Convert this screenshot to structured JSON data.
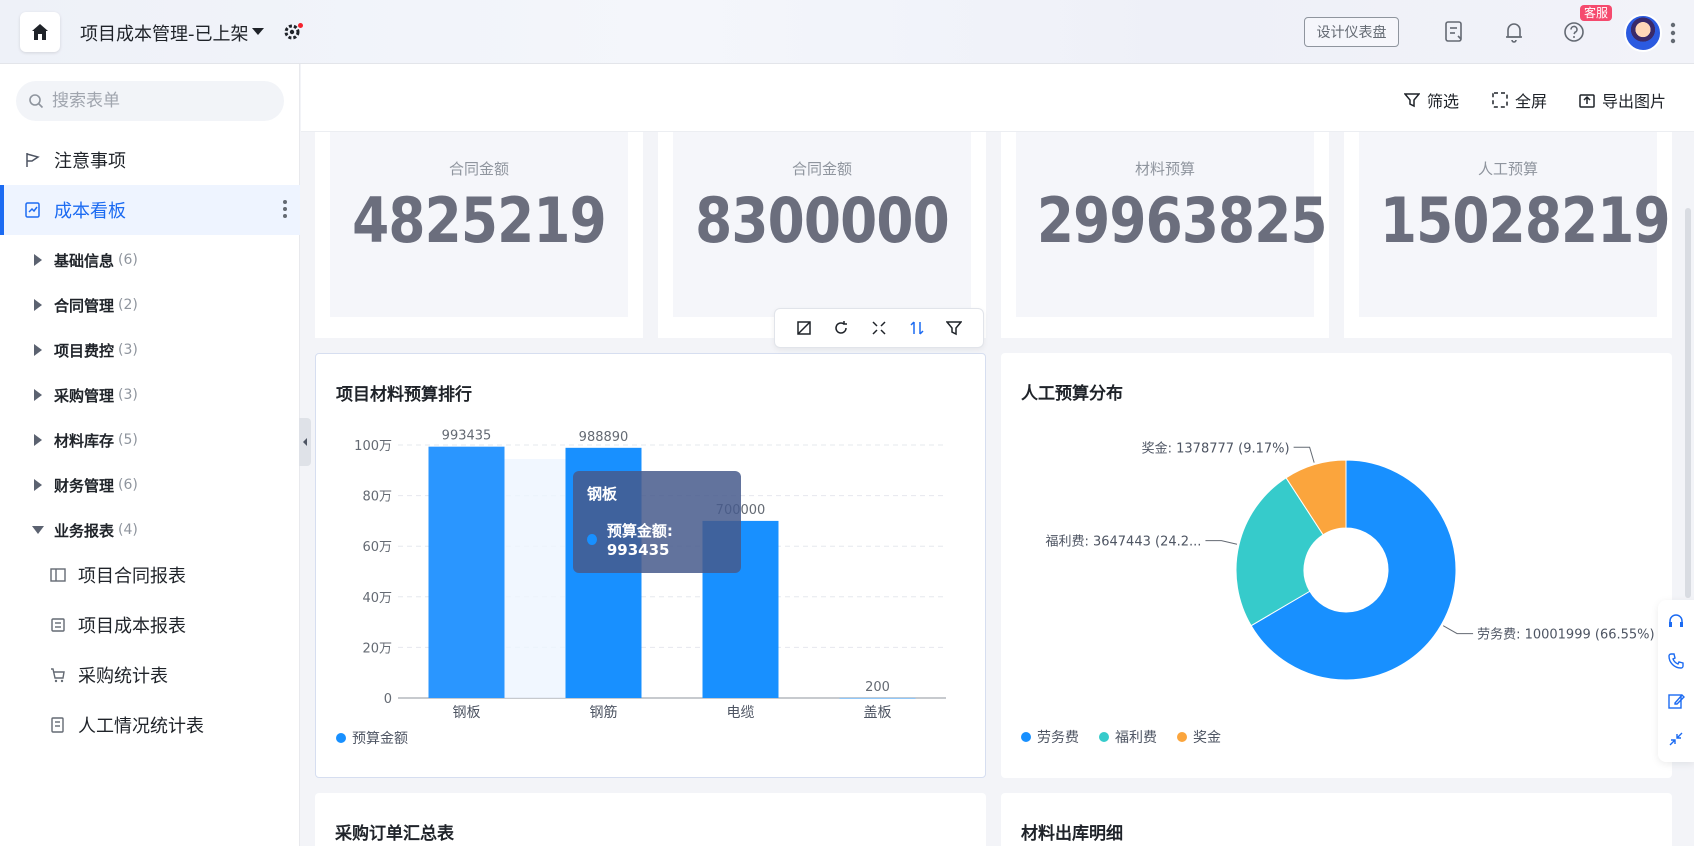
{
  "header": {
    "app_title": "项目成本管理-已上架",
    "design_button": "设计仪表盘",
    "support_badge": "客服"
  },
  "sidebar": {
    "search_placeholder": "搜索表单",
    "top_items": [
      {
        "label": "注意事项"
      },
      {
        "label": "成本看板"
      }
    ],
    "groups": [
      {
        "label": "基础信息",
        "count": "(6)"
      },
      {
        "label": "合同管理",
        "count": "(2)"
      },
      {
        "label": "项目费控",
        "count": "(3)"
      },
      {
        "label": "采购管理",
        "count": "(3)"
      },
      {
        "label": "材料库存",
        "count": "(5)"
      },
      {
        "label": "财务管理",
        "count": "(6)"
      },
      {
        "label": "业务报表",
        "count": "(4)"
      }
    ],
    "sub_items": [
      {
        "label": "项目合同报表"
      },
      {
        "label": "项目成本报表"
      },
      {
        "label": "采购统计表"
      },
      {
        "label": "人工情况统计表"
      }
    ]
  },
  "toolbar": {
    "filter": "筛选",
    "fullscreen": "全屏",
    "export": "导出图片"
  },
  "stats": [
    {
      "label": "合同金额",
      "value": "4825219"
    },
    {
      "label": "合同金额",
      "value": "8300000"
    },
    {
      "label": "材料预算",
      "value": "29963825"
    },
    {
      "label": "人工预算",
      "value": "15028219"
    }
  ],
  "panels": {
    "bar_title": "项目材料预算排行",
    "pie_title": "人工预算分布",
    "bottom_left_title": "采购订单汇总表",
    "bottom_right_title": "材料出库明细"
  },
  "tooltip": {
    "title": "钢板",
    "series": "预算金额",
    "value": "993435",
    "row": "预算金额: 993435"
  },
  "colors": {
    "accent": "#1c6bf2",
    "bar": "#1890ff",
    "labor": "#1890ff",
    "welfare": "#36cbcb",
    "bonus": "#fba53d"
  },
  "chart_data": [
    {
      "type": "bar",
      "title": "项目材料预算排行",
      "categories": [
        "钢板",
        "钢筋",
        "电缆",
        "盖板"
      ],
      "series": [
        {
          "name": "预算金额",
          "values": [
            993435,
            988890,
            700000,
            200
          ]
        }
      ],
      "data_labels": [
        "993435",
        "988890",
        "700000",
        "200"
      ],
      "yticks": [
        "0",
        "20万",
        "40万",
        "60万",
        "80万",
        "100万"
      ],
      "ylim": [
        0,
        1000000
      ],
      "grid": true,
      "legend": "bottom-left"
    },
    {
      "type": "pie",
      "title": "人工预算分布",
      "labels": [
        "劳务费",
        "福利费",
        "奖金"
      ],
      "values": [
        10001999,
        3647443,
        1378777
      ],
      "slice_labels": [
        "劳务费: 10001999 (66.55%)",
        "福利费: 3647443 (24.2...",
        "奖金: 1378777 (9.17%)"
      ],
      "donut": true,
      "legend": "bottom-left"
    }
  ]
}
